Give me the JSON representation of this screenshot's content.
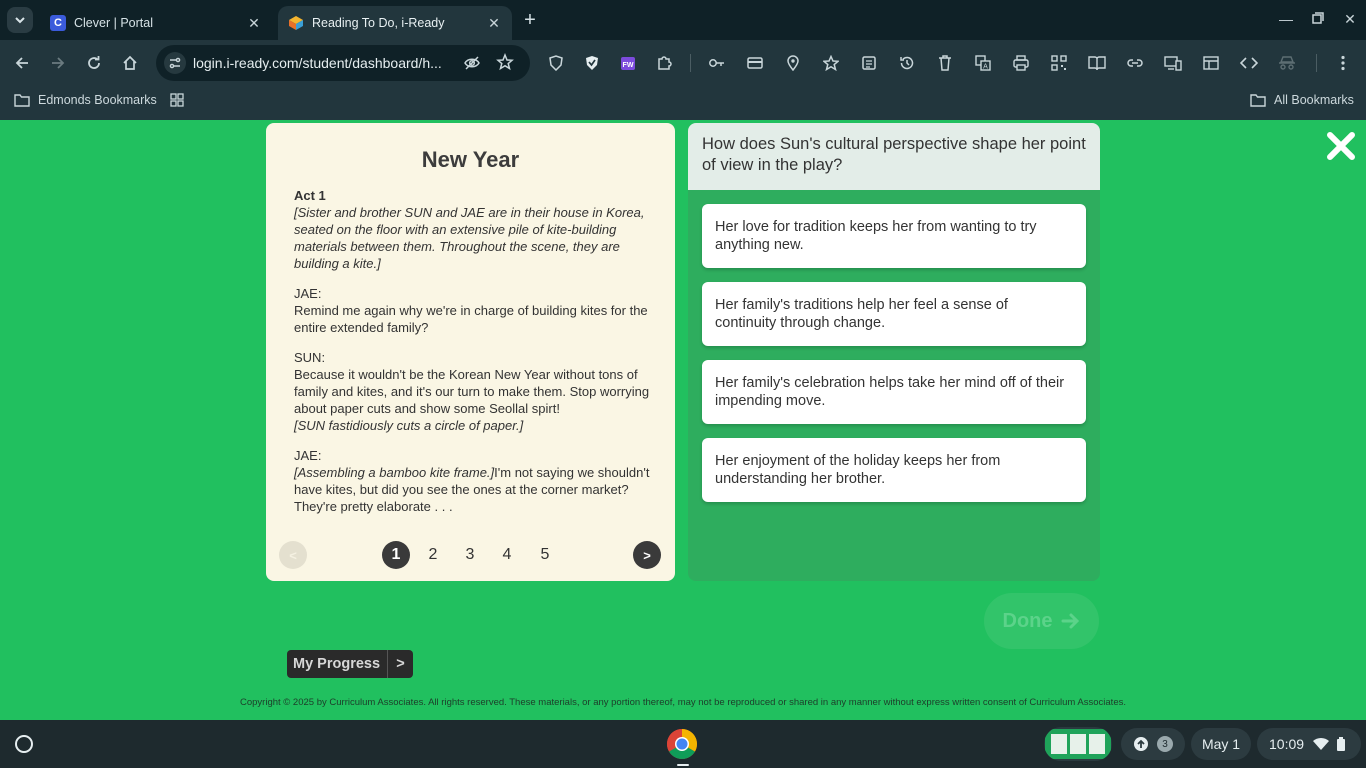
{
  "browser": {
    "tabs": [
      {
        "title": "Clever | Portal",
        "favicon_letter": "C",
        "favicon_color": "#3b5bdb"
      },
      {
        "title": "Reading To Do, i-Ready",
        "favicon_color": "#e8702a"
      }
    ],
    "url": "login.i-ready.com/student/dashboard/h...",
    "bookmarks": {
      "left": "Edmonds Bookmarks",
      "right": "All Bookmarks"
    }
  },
  "passage": {
    "title": "New Year",
    "act": "Act 1",
    "stage_direction_1": "[Sister and brother SUN and JAE are in their house in Korea, seated on the floor with an extensive pile of kite-building materials between them. Throughout the scene, they are building a kite.]",
    "speaker_1": "JAE:",
    "line_1": "Remind me again why we're in charge of building kites for the entire extended family?",
    "speaker_2": "SUN:",
    "line_2": "Because it wouldn't be the Korean New Year without tons of family and kites, and it's our turn to make them. Stop worrying about paper cuts and show some Seollal spirt!",
    "stage_direction_2": "[SUN fastidiously cuts a circle of paper.]",
    "speaker_3": "JAE:",
    "stage_direction_3": "[Assembling a bamboo kite frame.]",
    "line_3": "I'm not saying we shouldn't have kites, but did you see the ones at the corner market? They're pretty elaborate . . .",
    "pager": {
      "prev": "<",
      "next": ">",
      "pages": [
        "1",
        "2",
        "3",
        "4",
        "5"
      ],
      "current": "1"
    }
  },
  "question": {
    "text": "How does Sun's cultural perspective shape her point of view in the play?",
    "answers": [
      "Her love for tradition keeps her from wanting to try anything new.",
      "Her family's traditions help her feel a sense of continuity through change.",
      "Her family's celebration helps take her mind off of their impending move.",
      "Her enjoyment of the holiday keeps her from understanding her brother."
    ]
  },
  "done_label": "Done",
  "progress": {
    "label": "My Progress",
    "arrow": ">"
  },
  "copyright": "Copyright © 2025 by Curriculum Associates. All rights reserved. These materials, or any portion thereof, may not be reproduced or shared in any manner without express written consent of Curriculum Associates.",
  "shelf": {
    "notification_count": "3",
    "date": "May 1",
    "time": "10:09"
  },
  "colors": {
    "page_bg": "#21c05f",
    "passage_bg": "#faf6e4",
    "question_panel_bg": "#2ead5e",
    "question_bg": "#e3ede8"
  }
}
